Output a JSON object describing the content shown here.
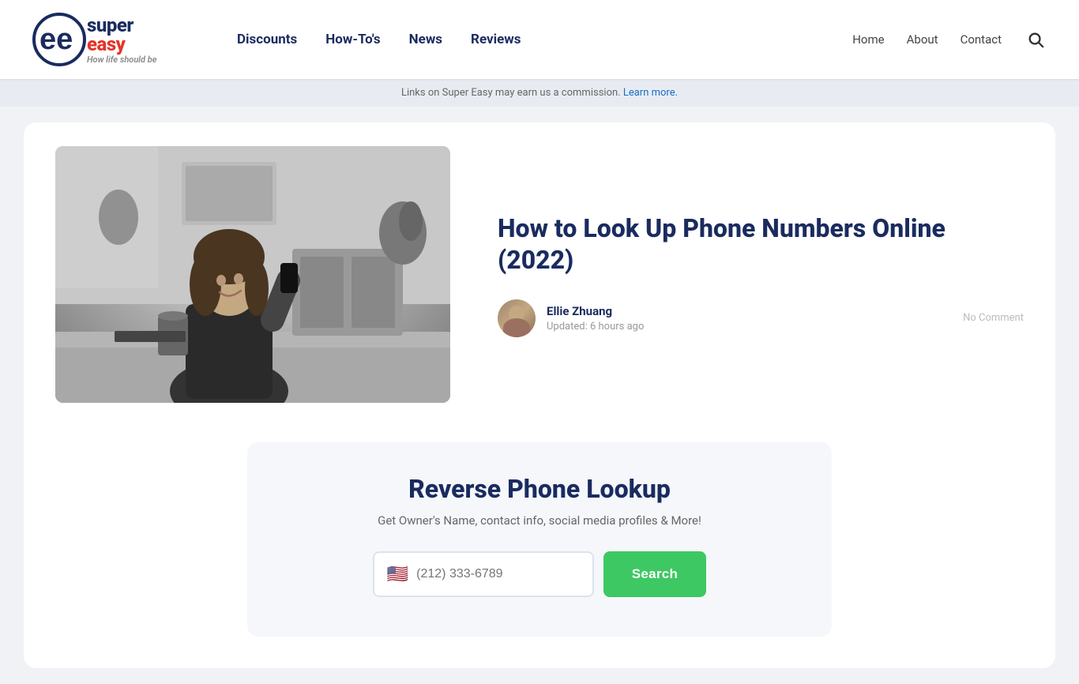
{
  "header": {
    "logo": {
      "super_text": "super",
      "easy_text": "easy",
      "tagline": "How life ",
      "tagline_emphasis": "should",
      "tagline_end": " be"
    },
    "primary_nav": [
      {
        "label": "Discounts",
        "id": "nav-discounts"
      },
      {
        "label": "How-To's",
        "id": "nav-howtos"
      },
      {
        "label": "News",
        "id": "nav-news"
      },
      {
        "label": "Reviews",
        "id": "nav-reviews"
      }
    ],
    "secondary_nav": [
      {
        "label": "Home",
        "id": "nav-home"
      },
      {
        "label": "About",
        "id": "nav-about"
      },
      {
        "label": "Contact",
        "id": "nav-contact"
      }
    ]
  },
  "commission_banner": {
    "text": "Links on Super Easy may earn us a commission. ",
    "link_text": "Learn more."
  },
  "article": {
    "title": "How to Look Up Phone Numbers Online (2022)",
    "author_name": "Ellie Zhuang",
    "updated_text": "Updated: 6 hours ago",
    "no_comment": "No Comment"
  },
  "widget": {
    "title": "Reverse Phone Lookup",
    "subtitle": "Get Owner's Name, contact info, social media profiles & More!",
    "input_placeholder": "(212) 333-6789",
    "search_button_label": "Search",
    "flag_emoji": "🇺🇸"
  }
}
